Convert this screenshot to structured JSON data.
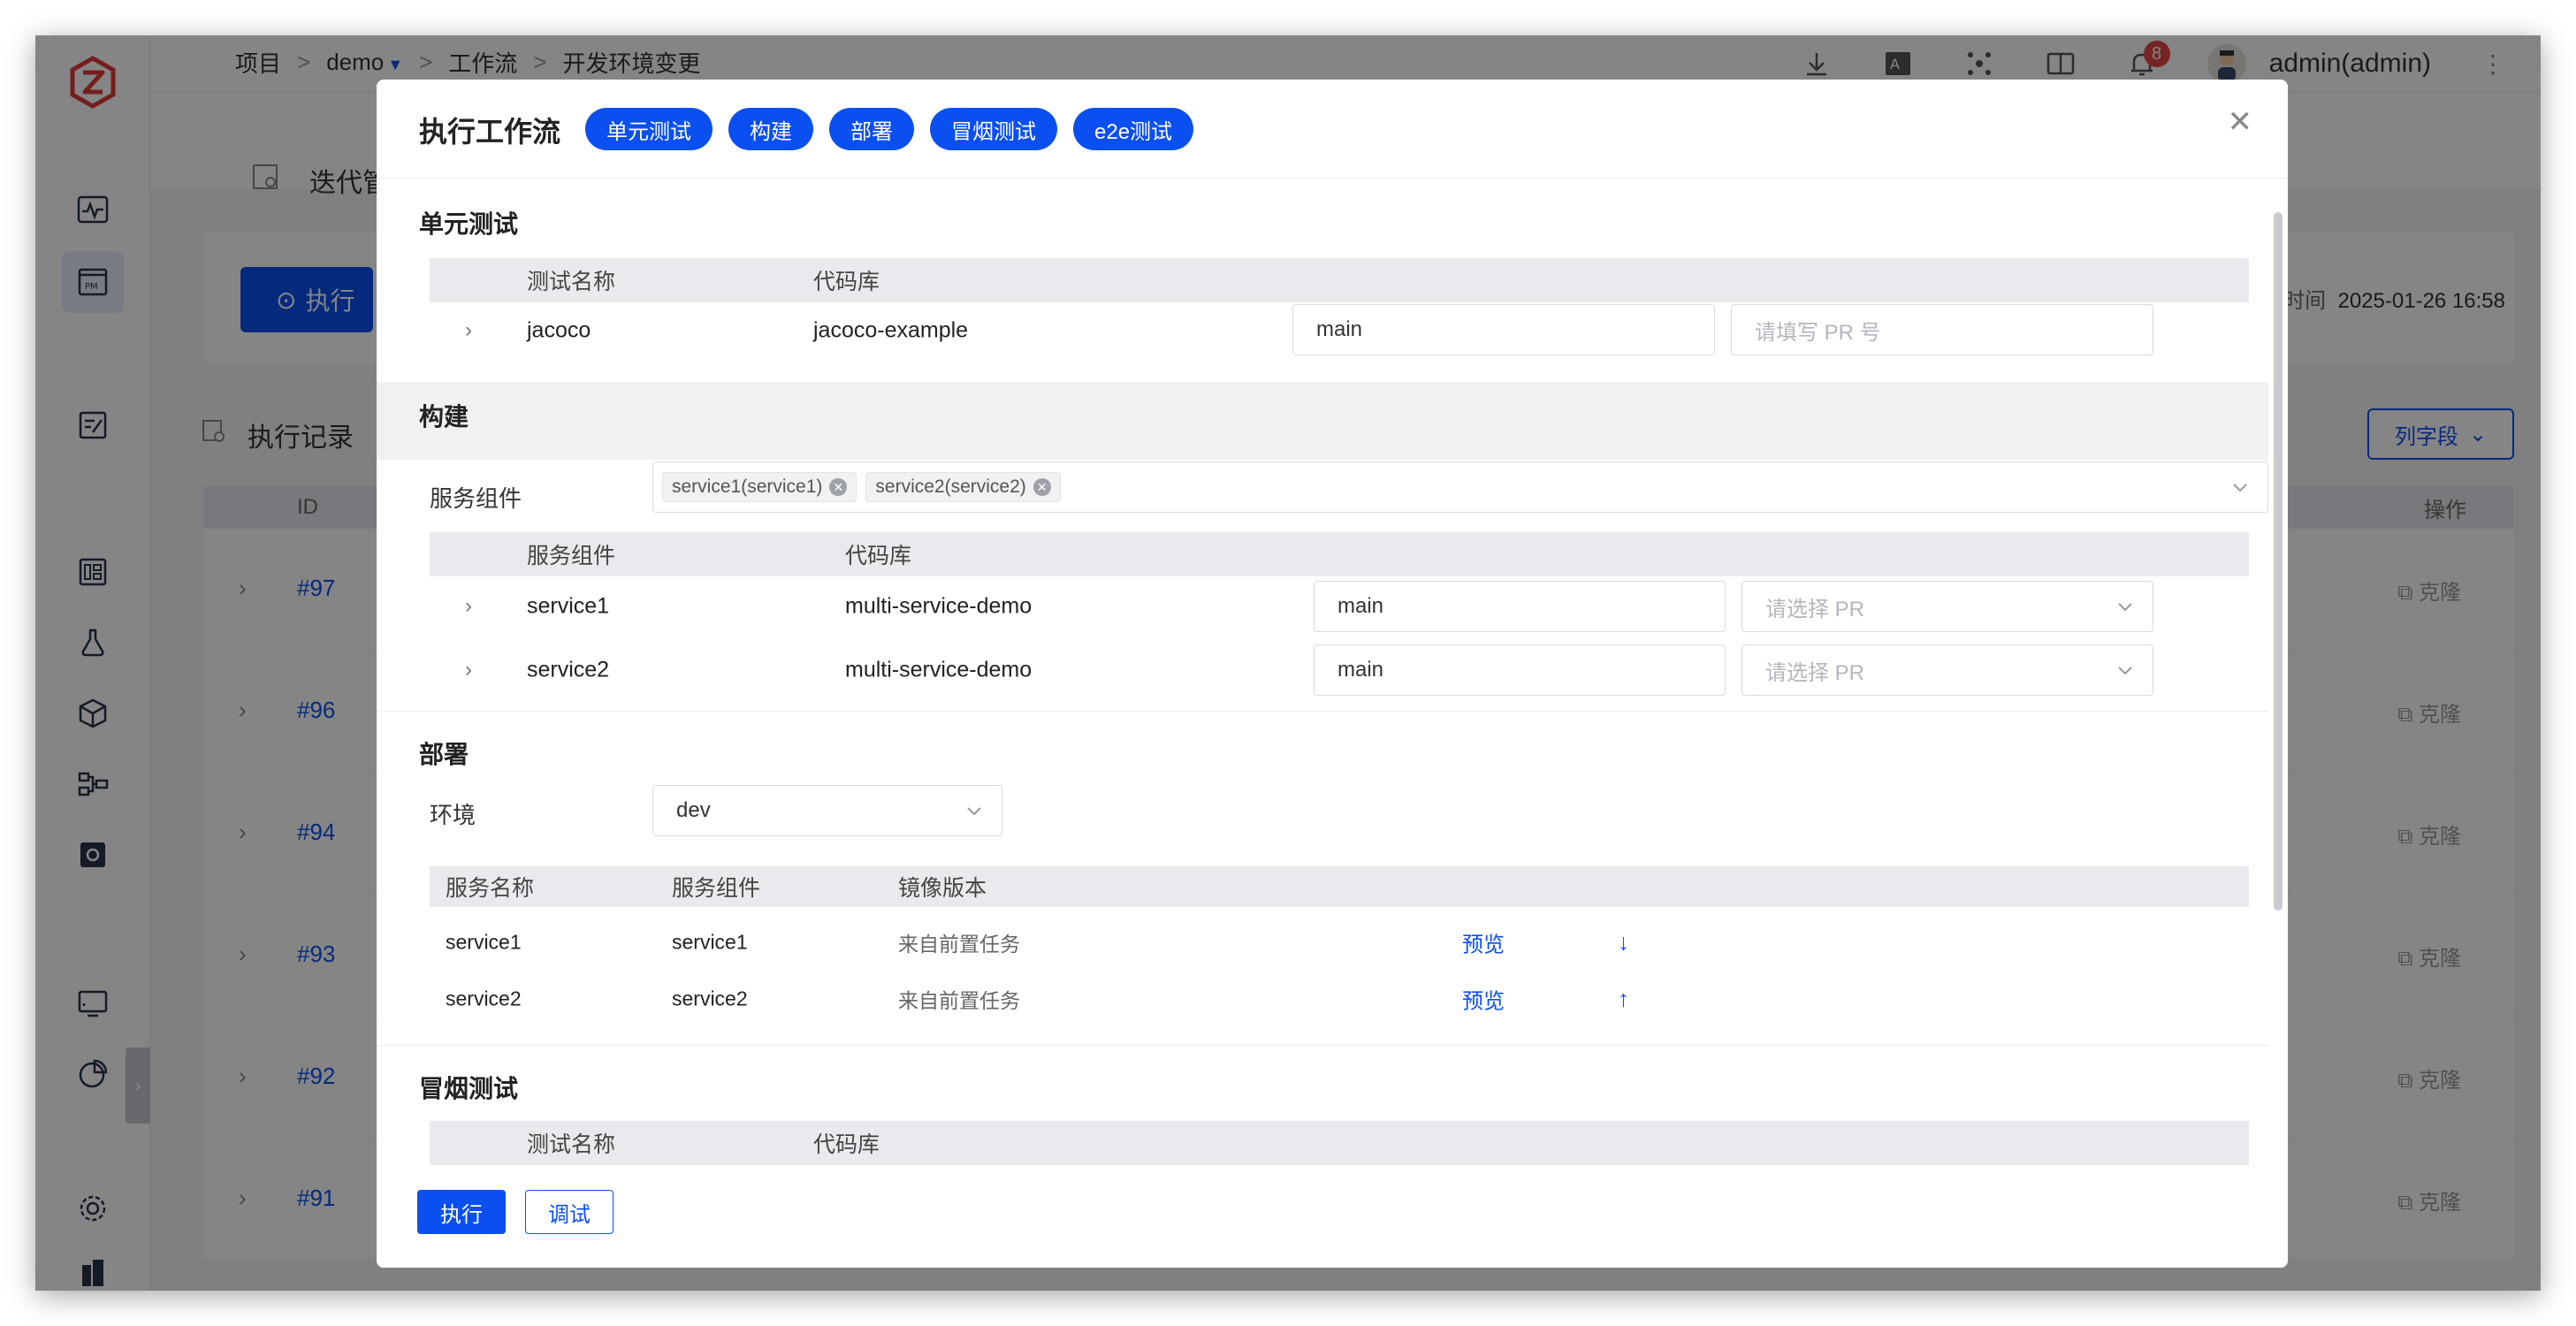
{
  "topbar": {
    "breadcrumb": [
      "项目",
      "demo",
      "工作流",
      "开发环境变更"
    ],
    "separator": ">",
    "notification_count": "8",
    "user": "admin(admin)"
  },
  "background": {
    "page_title": "迭代管",
    "execute_button": "执行",
    "last_time_label": "时间",
    "last_time": "2025-01-26 16:58",
    "records_title": "执行记录",
    "columns_button": "列字段",
    "table_headers": {
      "id": "ID",
      "op": "操作"
    },
    "rows": [
      {
        "id": "#97",
        "action": "克隆"
      },
      {
        "id": "#96",
        "action": "克隆"
      },
      {
        "id": "#94",
        "action": "克隆"
      },
      {
        "id": "#93",
        "action": "克隆"
      },
      {
        "id": "#92",
        "action": "克隆"
      },
      {
        "id": "#91",
        "action": "克隆"
      }
    ]
  },
  "modal": {
    "title": "执行工作流",
    "stage_pills": [
      "单元测试",
      "构建",
      "部署",
      "冒烟测试",
      "e2e测试"
    ],
    "unit_test": {
      "title": "单元测试",
      "headers": [
        "测试名称",
        "代码库"
      ],
      "rows": [
        {
          "name": "jacoco",
          "repo": "jacoco-example",
          "branch": "main",
          "pr_placeholder": "请填写 PR 号"
        }
      ]
    },
    "build": {
      "title": "构建",
      "service_label": "服务组件",
      "selected_tags": [
        "service1(service1)",
        "service2(service2)"
      ],
      "headers": [
        "服务组件",
        "代码库"
      ],
      "rows": [
        {
          "name": "service1",
          "repo": "multi-service-demo",
          "branch": "main",
          "pr_placeholder": "请选择 PR"
        },
        {
          "name": "service2",
          "repo": "multi-service-demo",
          "branch": "main",
          "pr_placeholder": "请选择 PR"
        }
      ]
    },
    "deploy": {
      "title": "部署",
      "env_label": "环境",
      "env_value": "dev",
      "headers": [
        "服务名称",
        "服务组件",
        "镜像版本"
      ],
      "rows": [
        {
          "service": "service1",
          "component": "service1",
          "image": "来自前置任务",
          "preview": "预览",
          "arrow": "down"
        },
        {
          "service": "service2",
          "component": "service2",
          "image": "来自前置任务",
          "preview": "预览",
          "arrow": "up"
        }
      ]
    },
    "smoke": {
      "title": "冒烟测试",
      "headers": [
        "测试名称",
        "代码库"
      ]
    },
    "footer": {
      "run": "执行",
      "debug": "调试"
    }
  }
}
